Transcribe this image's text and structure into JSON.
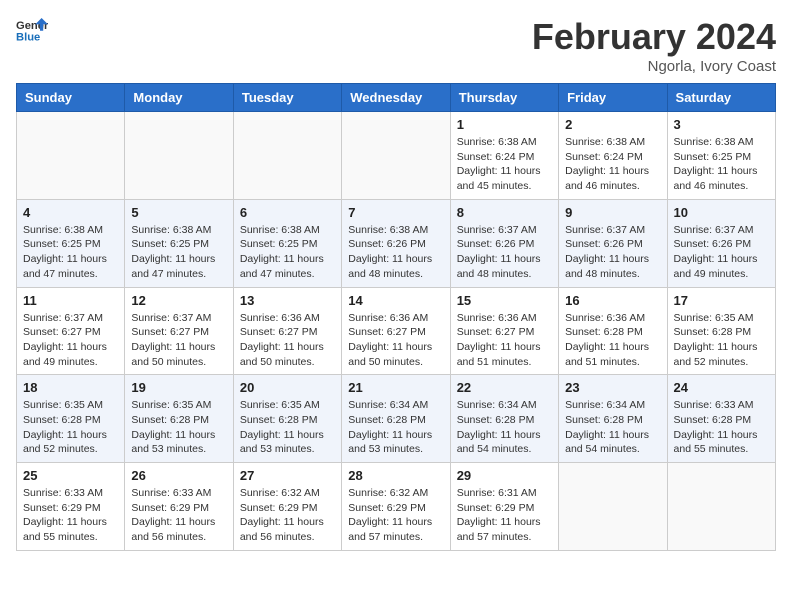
{
  "logo": {
    "text_general": "General",
    "text_blue": "Blue"
  },
  "title": {
    "month_year": "February 2024",
    "location": "Ngorla, Ivory Coast"
  },
  "days_of_week": [
    "Sunday",
    "Monday",
    "Tuesday",
    "Wednesday",
    "Thursday",
    "Friday",
    "Saturday"
  ],
  "weeks": [
    [
      {
        "num": "",
        "info": ""
      },
      {
        "num": "",
        "info": ""
      },
      {
        "num": "",
        "info": ""
      },
      {
        "num": "",
        "info": ""
      },
      {
        "num": "1",
        "info": "Sunrise: 6:38 AM\nSunset: 6:24 PM\nDaylight: 11 hours\nand 45 minutes."
      },
      {
        "num": "2",
        "info": "Sunrise: 6:38 AM\nSunset: 6:24 PM\nDaylight: 11 hours\nand 46 minutes."
      },
      {
        "num": "3",
        "info": "Sunrise: 6:38 AM\nSunset: 6:25 PM\nDaylight: 11 hours\nand 46 minutes."
      }
    ],
    [
      {
        "num": "4",
        "info": "Sunrise: 6:38 AM\nSunset: 6:25 PM\nDaylight: 11 hours\nand 47 minutes."
      },
      {
        "num": "5",
        "info": "Sunrise: 6:38 AM\nSunset: 6:25 PM\nDaylight: 11 hours\nand 47 minutes."
      },
      {
        "num": "6",
        "info": "Sunrise: 6:38 AM\nSunset: 6:25 PM\nDaylight: 11 hours\nand 47 minutes."
      },
      {
        "num": "7",
        "info": "Sunrise: 6:38 AM\nSunset: 6:26 PM\nDaylight: 11 hours\nand 48 minutes."
      },
      {
        "num": "8",
        "info": "Sunrise: 6:37 AM\nSunset: 6:26 PM\nDaylight: 11 hours\nand 48 minutes."
      },
      {
        "num": "9",
        "info": "Sunrise: 6:37 AM\nSunset: 6:26 PM\nDaylight: 11 hours\nand 48 minutes."
      },
      {
        "num": "10",
        "info": "Sunrise: 6:37 AM\nSunset: 6:26 PM\nDaylight: 11 hours\nand 49 minutes."
      }
    ],
    [
      {
        "num": "11",
        "info": "Sunrise: 6:37 AM\nSunset: 6:27 PM\nDaylight: 11 hours\nand 49 minutes."
      },
      {
        "num": "12",
        "info": "Sunrise: 6:37 AM\nSunset: 6:27 PM\nDaylight: 11 hours\nand 50 minutes."
      },
      {
        "num": "13",
        "info": "Sunrise: 6:36 AM\nSunset: 6:27 PM\nDaylight: 11 hours\nand 50 minutes."
      },
      {
        "num": "14",
        "info": "Sunrise: 6:36 AM\nSunset: 6:27 PM\nDaylight: 11 hours\nand 50 minutes."
      },
      {
        "num": "15",
        "info": "Sunrise: 6:36 AM\nSunset: 6:27 PM\nDaylight: 11 hours\nand 51 minutes."
      },
      {
        "num": "16",
        "info": "Sunrise: 6:36 AM\nSunset: 6:28 PM\nDaylight: 11 hours\nand 51 minutes."
      },
      {
        "num": "17",
        "info": "Sunrise: 6:35 AM\nSunset: 6:28 PM\nDaylight: 11 hours\nand 52 minutes."
      }
    ],
    [
      {
        "num": "18",
        "info": "Sunrise: 6:35 AM\nSunset: 6:28 PM\nDaylight: 11 hours\nand 52 minutes."
      },
      {
        "num": "19",
        "info": "Sunrise: 6:35 AM\nSunset: 6:28 PM\nDaylight: 11 hours\nand 53 minutes."
      },
      {
        "num": "20",
        "info": "Sunrise: 6:35 AM\nSunset: 6:28 PM\nDaylight: 11 hours\nand 53 minutes."
      },
      {
        "num": "21",
        "info": "Sunrise: 6:34 AM\nSunset: 6:28 PM\nDaylight: 11 hours\nand 53 minutes."
      },
      {
        "num": "22",
        "info": "Sunrise: 6:34 AM\nSunset: 6:28 PM\nDaylight: 11 hours\nand 54 minutes."
      },
      {
        "num": "23",
        "info": "Sunrise: 6:34 AM\nSunset: 6:28 PM\nDaylight: 11 hours\nand 54 minutes."
      },
      {
        "num": "24",
        "info": "Sunrise: 6:33 AM\nSunset: 6:28 PM\nDaylight: 11 hours\nand 55 minutes."
      }
    ],
    [
      {
        "num": "25",
        "info": "Sunrise: 6:33 AM\nSunset: 6:29 PM\nDaylight: 11 hours\nand 55 minutes."
      },
      {
        "num": "26",
        "info": "Sunrise: 6:33 AM\nSunset: 6:29 PM\nDaylight: 11 hours\nand 56 minutes."
      },
      {
        "num": "27",
        "info": "Sunrise: 6:32 AM\nSunset: 6:29 PM\nDaylight: 11 hours\nand 56 minutes."
      },
      {
        "num": "28",
        "info": "Sunrise: 6:32 AM\nSunset: 6:29 PM\nDaylight: 11 hours\nand 57 minutes."
      },
      {
        "num": "29",
        "info": "Sunrise: 6:31 AM\nSunset: 6:29 PM\nDaylight: 11 hours\nand 57 minutes."
      },
      {
        "num": "",
        "info": ""
      },
      {
        "num": "",
        "info": ""
      }
    ]
  ]
}
